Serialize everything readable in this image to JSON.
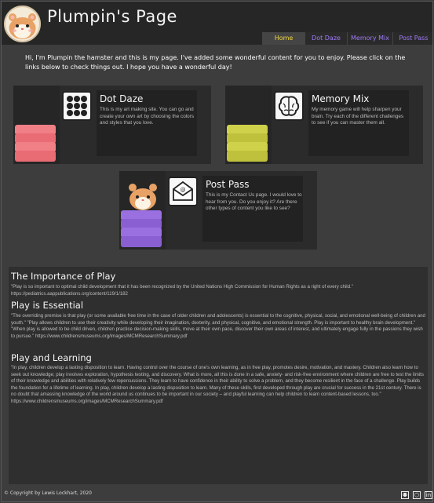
{
  "header": {
    "title": "Plumpin's Page",
    "nav": [
      {
        "label": "Home",
        "active": true
      },
      {
        "label": "Dot Daze",
        "active": false
      },
      {
        "label": "Memory Mix",
        "active": false
      },
      {
        "label": "Post Pass",
        "active": false
      }
    ]
  },
  "intro": "Hi, I'm Plumpin the hamster and this is my page. I've added some wonderful content for you to enjoy. Please click on the links below to check things out. I hope you have a wonderful day!",
  "cards": [
    {
      "title": "Dot Daze",
      "desc": "This is my art making site. You can go and create your own art by choosing the colors and styles that you love.",
      "icon": "dots-grid-icon",
      "stack_color": "#f07f86"
    },
    {
      "title": "Memory Mix",
      "desc": "My memory game will help sharpen your brain. Try each of the different challenges to see if you can master them all.",
      "icon": "brain-icon",
      "stack_color": "#cfd14a"
    },
    {
      "title": "Post Pass",
      "desc": "This is my Contact Us page. I would love to hear from you. Do you enjoy it? Are there other types of content you like to see?",
      "icon": "envelope-icon",
      "stack_color": "#9a6fe0"
    }
  ],
  "article": {
    "sections": [
      {
        "heading": "The Importance of Play",
        "text": "\"Play is so important to optimal child development that it has been recognized by the United Nations High Commission for Human Rights as a right of every child.\" https://pediatrics.aappublications.org/content/119/1/182"
      },
      {
        "heading": "Play is Essential",
        "text": "\"The overriding premise is that play (or some available free time in the case of older children and adolescents) is essential to the cognitive, physical, social, and emotional well-being of children and youth.\" \"Play allows children to use their creativity while developing their imagination, dexterity, and physical, cognitive, and emotional strength. Play is important to healthy brain development.\" \"When play is allowed to be child driven, children practice decision-making skills, move at their own pace, discover their own areas of interest, and ultimately engage fully in the passions they wish to pursue.\" https://www.childrensmuseums.org/images/MCMResearchSummary.pdf"
      },
      {
        "heading": "Play and Learning",
        "text": "\"In play, children develop a lasting disposition to learn. Having control over the course of one's own learning, as in free play, promotes desire, motivation, and mastery. Children also learn how to seek out knowledge; play involves exploration, hypothesis testing, and discovery. What is more, all this is done in a safe, anxiety- and risk-free environment where children are free to test the limits of their knowledge and abilities with relatively few repercussions. They learn to have confidence in their ability to solve a problem, and they become resilient in the face of a challenge. Play builds the foundation for a lifetime of learning. In play, children develop a lasting disposition to learn. Many of these skills, first developed through play are crucial for success in the 21st century. There is no doubt that amassing knowledge of the world around us continues to be important in our society – and playful learning can help children to learn content-based lessons, too.\" https://www.childrensmuseums.org/images/MCMResearchSummary.pdf"
      }
    ]
  },
  "footer": {
    "copyright": "© Copyright by Lewis Lockhart, 2020",
    "social": [
      {
        "icon": "github-icon",
        "glyph": "⚉"
      },
      {
        "icon": "codepen-icon",
        "glyph": "⬡"
      },
      {
        "icon": "linkedin-icon",
        "glyph": "in"
      }
    ]
  },
  "colors": {
    "accent": "#9e7bf5",
    "active_nav": "#f0d640",
    "background": "#3d3d3d",
    "header": "#262626"
  }
}
